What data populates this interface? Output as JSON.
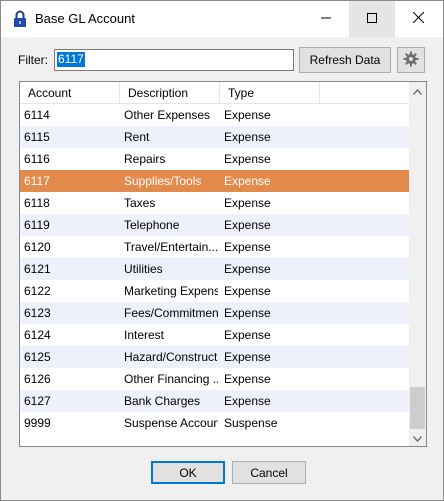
{
  "window": {
    "title": "Base GL Account"
  },
  "filter": {
    "label": "Filter:",
    "value": "6117"
  },
  "toolbar": {
    "refresh_label": "Refresh Data"
  },
  "grid": {
    "columns": [
      "Account",
      "Description",
      "Type"
    ],
    "selected_index": 3,
    "rows": [
      {
        "account": "6114",
        "description": "Other Expenses",
        "type": "Expense"
      },
      {
        "account": "6115",
        "description": "Rent",
        "type": "Expense"
      },
      {
        "account": "6116",
        "description": "Repairs",
        "type": "Expense"
      },
      {
        "account": "6117",
        "description": "Supplies/Tools",
        "type": "Expense"
      },
      {
        "account": "6118",
        "description": "Taxes",
        "type": "Expense"
      },
      {
        "account": "6119",
        "description": "Telephone",
        "type": "Expense"
      },
      {
        "account": "6120",
        "description": "Travel/Entertain...",
        "type": "Expense"
      },
      {
        "account": "6121",
        "description": "Utilities",
        "type": "Expense"
      },
      {
        "account": "6122",
        "description": "Marketing Expense",
        "type": "Expense"
      },
      {
        "account": "6123",
        "description": "Fees/Commitments",
        "type": "Expense"
      },
      {
        "account": "6124",
        "description": "Interest",
        "type": "Expense"
      },
      {
        "account": "6125",
        "description": "Hazard/Construct...",
        "type": "Expense"
      },
      {
        "account": "6126",
        "description": "Other Financing ...",
        "type": "Expense"
      },
      {
        "account": "6127",
        "description": "Bank Charges",
        "type": "Expense"
      },
      {
        "account": "9999",
        "description": "Suspense Account",
        "type": "Suspense"
      }
    ]
  },
  "footer": {
    "ok_label": "OK",
    "cancel_label": "Cancel"
  },
  "colors": {
    "selected_row": "#e38b4c",
    "alt_row": "#eef0fb",
    "focus_blue": "#0078d7"
  },
  "icons": {
    "title": "lock-icon",
    "gear": "gear-icon",
    "minimize": "minimize-icon",
    "maximize": "maximize-icon",
    "close": "close-icon"
  }
}
